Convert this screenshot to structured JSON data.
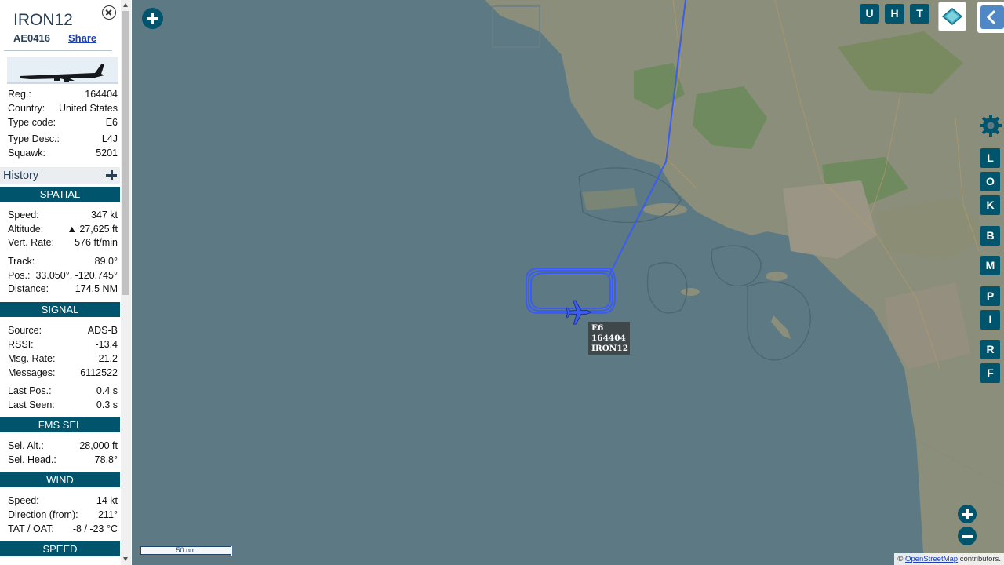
{
  "aircraft": {
    "callsign": "IRON12",
    "hex": "AE0416",
    "share_label": "Share",
    "photo_alt": "aircraft-photo"
  },
  "info_rows": [
    {
      "label": "Reg.:",
      "value": "164404"
    },
    {
      "label": "Country:",
      "value": "United States"
    },
    {
      "label": "Type code:",
      "value": "E6"
    },
    {
      "label": "Type Desc.:",
      "value": "L4J"
    },
    {
      "label": "Squawk:",
      "value": "5201"
    }
  ],
  "history_label": "History",
  "sections": {
    "spatial": {
      "title": "SPATIAL",
      "rows": [
        {
          "label": "Speed:",
          "value": "347 kt"
        },
        {
          "label": "Altitude:",
          "value": "▲ 27,625 ft"
        },
        {
          "label": "Vert. Rate:",
          "value": "576 ft/min"
        },
        {
          "label": "Track:",
          "value": "89.0°"
        },
        {
          "label": "Pos.:",
          "value": "33.050°, -120.745°"
        },
        {
          "label": "Distance:",
          "value": "174.5 NM"
        }
      ]
    },
    "signal": {
      "title": "SIGNAL",
      "rows": [
        {
          "label": "Source:",
          "value": "ADS-B"
        },
        {
          "label": "RSSI:",
          "value": "-13.4"
        },
        {
          "label": "Msg. Rate:",
          "value": "21.2"
        },
        {
          "label": "Messages:",
          "value": "6112522"
        },
        {
          "label": "Last Pos.:",
          "value": "0.4 s"
        },
        {
          "label": "Last Seen:",
          "value": "0.3 s"
        }
      ]
    },
    "fms": {
      "title": "FMS SEL",
      "rows": [
        {
          "label": "Sel. Alt.:",
          "value": "28,000 ft"
        },
        {
          "label": "Sel. Head.:",
          "value": "78.8°"
        }
      ]
    },
    "wind": {
      "title": "WIND",
      "rows": [
        {
          "label": "Speed:",
          "value": "14 kt"
        },
        {
          "label": "Direction (from):",
          "value": "211°"
        },
        {
          "label": "TAT / OAT:",
          "value": "-8 / -23 °C"
        }
      ]
    },
    "speed": {
      "title": "SPEED"
    }
  },
  "map": {
    "top_buttons": [
      "U",
      "H",
      "T"
    ],
    "side_buttons": [
      "L",
      "O",
      "K",
      "B",
      "M",
      "P",
      "I",
      "R",
      "F"
    ],
    "scale_label": "50 nm",
    "attribution_prefix": "© ",
    "attribution_link": "OpenStreetMap",
    "attribution_suffix": " contributors.",
    "plane_label": {
      "line1": "E6",
      "line2": "164404",
      "line3": "IRON12"
    },
    "colors": {
      "track": "#3a5cf0",
      "button": "#00546c",
      "sea": "#5d7a84"
    }
  }
}
